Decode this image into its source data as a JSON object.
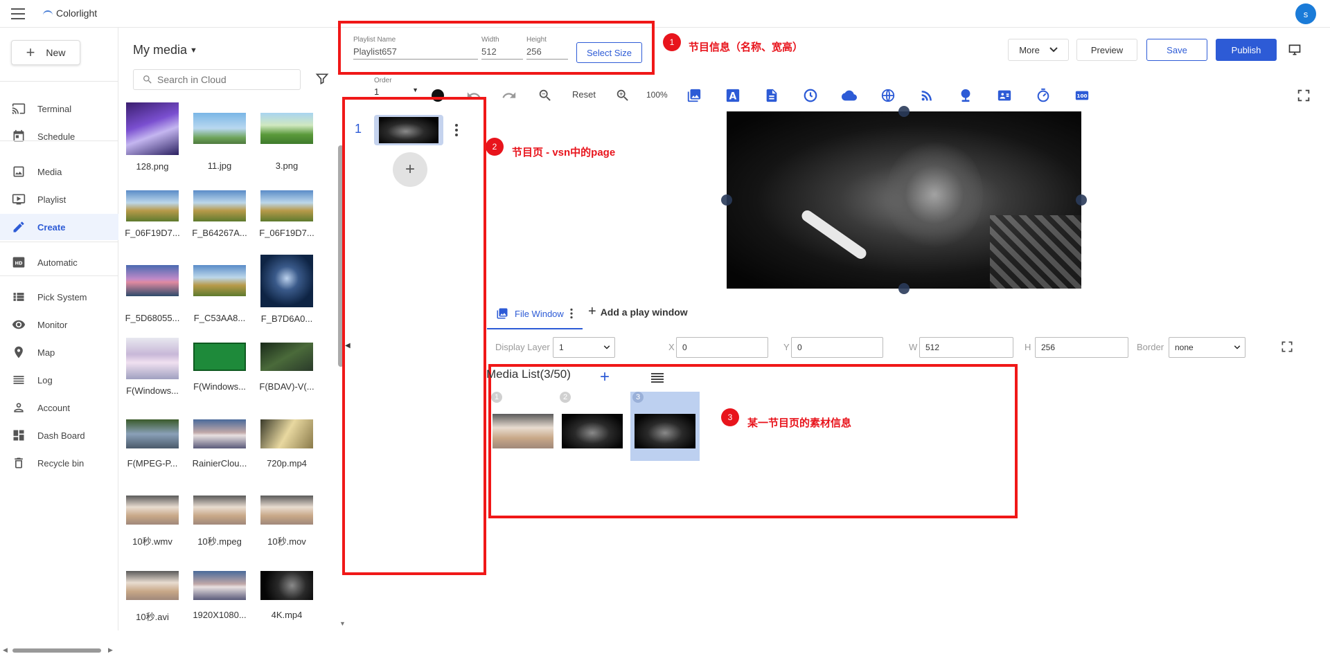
{
  "app": {
    "logo_text": "Colorlight",
    "user_initial": "s"
  },
  "nav": {
    "new_label": "New",
    "items": [
      {
        "label": "Terminal",
        "icon": "cast-icon"
      },
      {
        "label": "Schedule",
        "icon": "calendar-icon"
      },
      {
        "label": "Media",
        "icon": "image-icon"
      },
      {
        "label": "Playlist",
        "icon": "playlist-tv-icon"
      },
      {
        "label": "Create",
        "icon": "pencil-icon"
      },
      {
        "label": "Automatic",
        "icon": "hd-icon"
      },
      {
        "label": "Pick System",
        "icon": "grid-list-icon"
      },
      {
        "label": "Monitor",
        "icon": "eye-icon"
      },
      {
        "label": "Map",
        "icon": "map-pin-icon"
      },
      {
        "label": "Log",
        "icon": "lines-icon"
      },
      {
        "label": "Account",
        "icon": "person-icon"
      },
      {
        "label": "Dash Board",
        "icon": "dashboard-icon"
      },
      {
        "label": "Recycle bin",
        "icon": "trash-icon"
      }
    ]
  },
  "media": {
    "title": "My media",
    "search_placeholder": "Search in Cloud",
    "items": [
      {
        "name": "128.png"
      },
      {
        "name": "11.jpg"
      },
      {
        "name": "3.png"
      },
      {
        "name": "F_06F19D7..."
      },
      {
        "name": "F_B64267A..."
      },
      {
        "name": "F_06F19D7..."
      },
      {
        "name": "F_5D68055..."
      },
      {
        "name": "F_C53AA8..."
      },
      {
        "name": "F_B7D6A0..."
      },
      {
        "name": "F(Windows..."
      },
      {
        "name": "F(Windows..."
      },
      {
        "name": "F(BDAV)-V(..."
      },
      {
        "name": "F(MPEG-P..."
      },
      {
        "name": "RainierClou..."
      },
      {
        "name": "720p.mp4"
      },
      {
        "name": "10秒.wmv"
      },
      {
        "name": "10秒.mpeg"
      },
      {
        "name": "10秒.mov"
      },
      {
        "name": "10秒.avi"
      },
      {
        "name": "1920X1080..."
      },
      {
        "name": "4K.mp4"
      }
    ]
  },
  "playlist": {
    "name_label": "Playlist Name",
    "name_value": "Playlist657",
    "width_label": "Width",
    "width_value": "512",
    "height_label": "Height",
    "height_value": "256",
    "select_size": "Select Size"
  },
  "actions": {
    "more": "More",
    "preview": "Preview",
    "save": "Save",
    "publish": "Publish"
  },
  "toolbar": {
    "order_label": "Order",
    "order_value": "1",
    "reset": "Reset",
    "zoom": "100%"
  },
  "pages": {
    "items": [
      {
        "num": "1"
      }
    ]
  },
  "window": {
    "tab_label": "File Window",
    "add_label": "Add a play window",
    "display_layer_label": "Display Layer",
    "display_layer_value": "1",
    "x_label": "X",
    "x_value": "0",
    "y_label": "Y",
    "y_value": "0",
    "w_label": "W",
    "w_value": "512",
    "h_label": "H",
    "h_value": "256",
    "border_label": "Border",
    "border_value": "none"
  },
  "media_list": {
    "title": "Media List(3/50)",
    "items": [
      {
        "num": "1"
      },
      {
        "num": "2"
      },
      {
        "num": "3"
      }
    ]
  },
  "annotations": {
    "a1_num": "1",
    "a1_text": "节目信息（名称、宽高）",
    "a2_num": "2",
    "a2_text": "节目页 - vsn中的page",
    "a3_num": "3",
    "a3_text": "某一节目页的素材信息"
  },
  "colors": {
    "accent": "#2d5bd6",
    "annotation_red": "#e8141c",
    "avatar_blue": "#1a7bd8"
  }
}
